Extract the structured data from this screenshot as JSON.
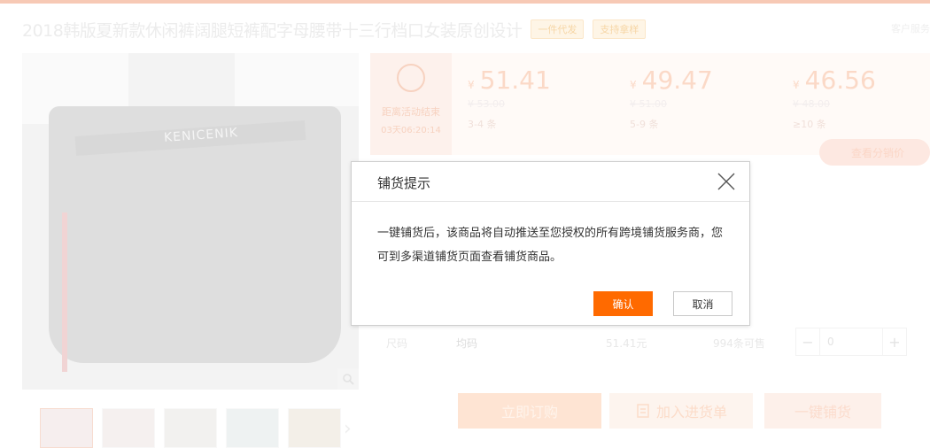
{
  "product": {
    "title": "2018韩版夏新款休闲裤阔腿短裤配字母腰带十三行档口女装原创设计",
    "tags": [
      "一件代发",
      "支持拿样"
    ],
    "right_link": "客户服务",
    "belt_text": "KENICENIK"
  },
  "price": {
    "countdown_label": "距离活动结束",
    "countdown_time": "03天06:20:14",
    "tiers": [
      {
        "currency": "¥",
        "price": "51.41",
        "old": "¥ 53.00",
        "qty": "3-4 条"
      },
      {
        "currency": "¥",
        "price": "49.47",
        "old": "¥ 51.00",
        "qty": "5-9 条"
      },
      {
        "currency": "¥",
        "price": "46.56",
        "old": "¥ 48.00",
        "qty": "≥10 条"
      }
    ],
    "distributor_label": "查看分销价"
  },
  "sku": {
    "label": "尺码",
    "name": "均码",
    "price": "51.41元",
    "stock": "994条可售",
    "quantity": "0",
    "minus": "−",
    "plus": "+"
  },
  "actions": {
    "buy": "立即订购",
    "cart": "加入进货单",
    "onekey": "一键铺货"
  },
  "modal": {
    "title": "铺货提示",
    "body": "一键铺货后，该商品将自动推送至您授权的所有跨境铺货服务商，您可到多渠道铺货页面查看铺货商品。",
    "confirm": "确认",
    "cancel": "取消"
  },
  "colors": {
    "accent": "#ff6a00",
    "modal_border": "#cfcfcf"
  },
  "icons": [
    "alarm-clock-icon",
    "zoom-icon",
    "close-icon",
    "cart-icon",
    "chevron-right-icon"
  ]
}
